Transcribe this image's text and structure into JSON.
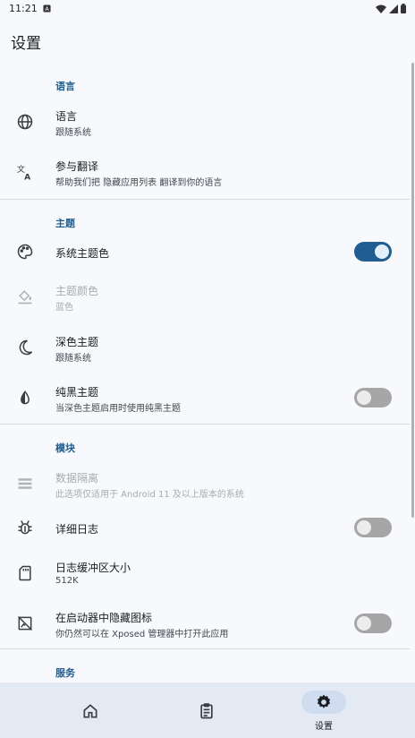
{
  "status_bar": {
    "time": "11:21"
  },
  "page_title": "设置",
  "sections": {
    "language": {
      "header": "语言",
      "items": [
        {
          "label": "语言",
          "sub": "跟随系统"
        },
        {
          "label": "参与翻译",
          "sub": "帮助我们把 隐藏应用列表 翻译到你的语言"
        }
      ]
    },
    "theme": {
      "header": "主题",
      "items": [
        {
          "label": "系统主题色",
          "toggle": true
        },
        {
          "label": "主题颜色",
          "sub": "蓝色",
          "disabled": true
        },
        {
          "label": "深色主题",
          "sub": "跟随系统"
        },
        {
          "label": "纯黑主题",
          "sub": "当深色主题启用时使用纯黑主题",
          "toggle": false
        }
      ]
    },
    "module": {
      "header": "模块",
      "items": [
        {
          "label": "数据隔离",
          "sub": "此选项仅适用于 Android 11 及以上版本的系统",
          "disabled": true
        },
        {
          "label": "详细日志",
          "toggle": false
        },
        {
          "label": "日志缓冲区大小",
          "sub": "512K"
        },
        {
          "label": "在启动器中隐藏图标",
          "sub": "你仍然可以在 Xposed 管理器中打开此应用",
          "toggle": false
        }
      ]
    },
    "service": {
      "header": "服务"
    }
  },
  "bottom_nav": {
    "items": [
      {
        "icon": "home-icon",
        "label": ""
      },
      {
        "icon": "clipboard-icon",
        "label": ""
      },
      {
        "icon": "gear-icon",
        "label": "设置",
        "selected": true
      }
    ]
  },
  "colors": {
    "accent": "#1f5d92",
    "background": "#f7f9fc",
    "nav_background": "#e3eaf3"
  }
}
